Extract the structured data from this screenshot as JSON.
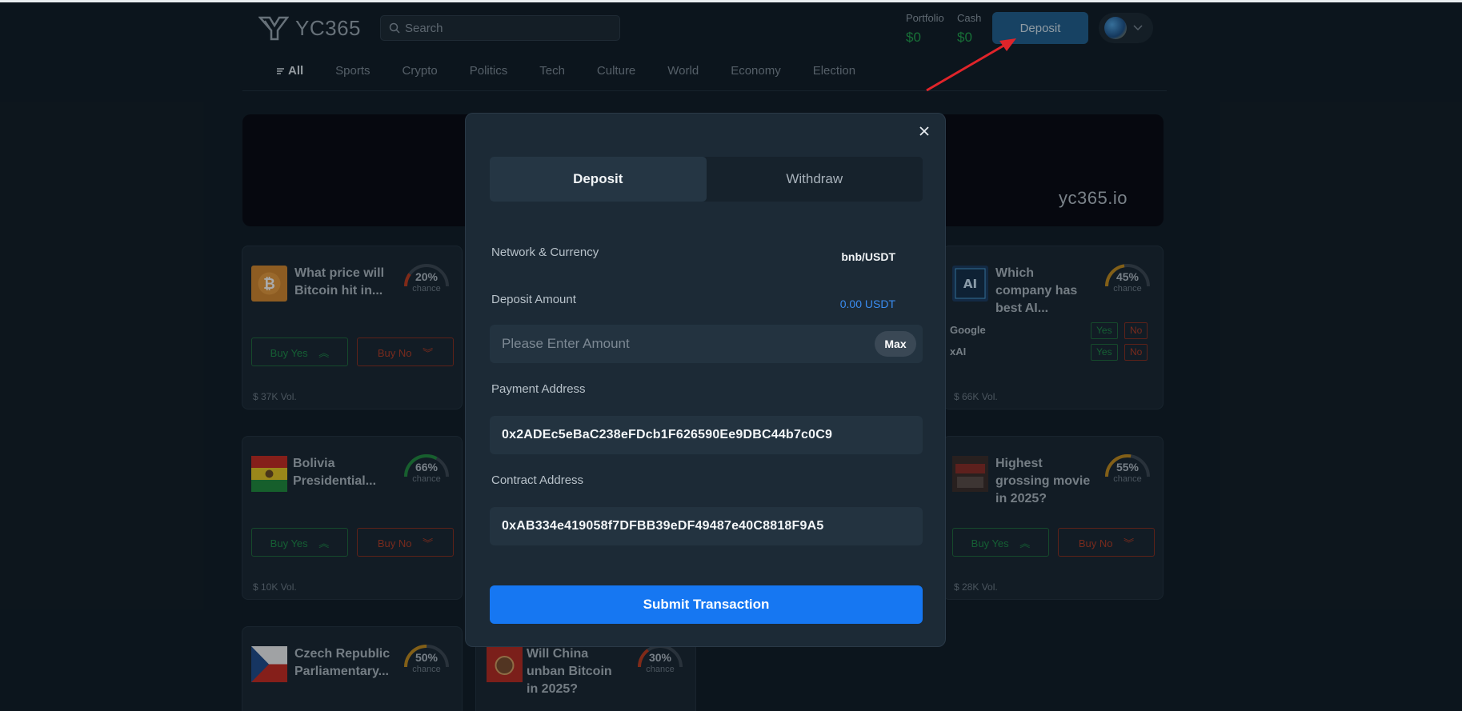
{
  "app": {
    "name": "YC365"
  },
  "search": {
    "placeholder": "Search"
  },
  "balances": {
    "portfolio_label": "Portfolio",
    "portfolio_value": "$0",
    "cash_label": "Cash",
    "cash_value": "$0"
  },
  "header": {
    "deposit_label": "Deposit"
  },
  "nav": {
    "items": [
      "All",
      "Sports",
      "Crypto",
      "Politics",
      "Tech",
      "Culture",
      "World",
      "Economy",
      "Election"
    ]
  },
  "banner": {
    "text": "yc365.io"
  },
  "markets": [
    {
      "title": "What price will Bitcoin hit in...",
      "chance": "20%",
      "chance_value": 20,
      "gauge_color": "#c0391b",
      "chance_label": "chance",
      "buy_yes": "Buy Yes",
      "buy_no": "Buy No",
      "volume": "$ 37K Vol."
    },
    {
      "title": "Which company has best AI...",
      "chance": "45%",
      "chance_value": 45,
      "gauge_color": "#c48a1a",
      "chance_label": "chance",
      "options": [
        {
          "name": "Google",
          "yes": "Yes",
          "no": "No"
        },
        {
          "name": "xAI",
          "yes": "Yes",
          "no": "No"
        }
      ],
      "volume": "$ 66K Vol."
    },
    {
      "title": "Bolivia Presidential...",
      "chance": "66%",
      "chance_value": 66,
      "gauge_color": "#1f8a3c",
      "chance_label": "chance",
      "buy_yes": "Buy Yes",
      "buy_no": "Buy No",
      "volume": "$ 10K Vol."
    },
    {
      "title": "Highest grossing movie in 2025?",
      "chance": "55%",
      "chance_value": 55,
      "gauge_color": "#c48a1a",
      "chance_label": "chance",
      "buy_yes": "Buy Yes",
      "buy_no": "Buy No",
      "volume": "$ 28K Vol."
    },
    {
      "title": "Czech Republic Parliamentary...",
      "chance": "50%",
      "chance_value": 50,
      "gauge_color": "#c48a1a",
      "chance_label": "chance"
    },
    {
      "title": "Will China unban Bitcoin in 2025?",
      "chance": "30%",
      "chance_value": 30,
      "gauge_color": "#c0391b",
      "chance_label": "chance"
    }
  ],
  "modal": {
    "tabs": [
      "Deposit",
      "Withdraw"
    ],
    "network_label": "Network & Currency",
    "network_value": "bnb/USDT",
    "amount_label": "Deposit Amount",
    "amount_value": "0.00 USDT",
    "amount_placeholder": "Please Enter Amount",
    "max_label": "Max",
    "payment_label": "Payment Address",
    "payment_address": "0x2ADEc5eBaC238eFDcb1F626590Ee9DBC44b7c0C9",
    "contract_label": "Contract Address",
    "contract_address": "0xAB334e419058f7DFBB39eDF49487e40C8818F9A5",
    "submit_label": "Submit Transaction"
  },
  "colors": {
    "accent": "#1677f2",
    "positive": "#1fa34a",
    "negative": "#b33a22",
    "annotation_arrow": "#e0242a",
    "amount_value": "#3a8cf0"
  },
  "icons": [
    "logo-icon",
    "search-icon",
    "chevron-down-icon",
    "menu-icon",
    "close-icon",
    "chevron-up-double-icon",
    "chevron-down-double-icon"
  ]
}
